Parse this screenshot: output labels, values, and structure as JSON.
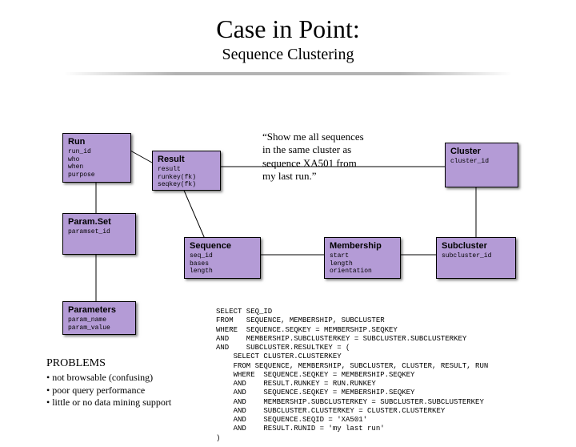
{
  "title": "Case in Point:",
  "subtitle": "Sequence Clustering",
  "quote": "“Show me all sequences\nin the same cluster as\nsequence XA501 from\nmy last run.”",
  "boxes": {
    "run": {
      "title": "Run",
      "fields": "run_id\nwho\nwhen\npurpose"
    },
    "result": {
      "title": "Result",
      "fields": "result\nrunkey(fk)\nseqkey(fk)"
    },
    "cluster": {
      "title": "Cluster",
      "fields": "cluster_id"
    },
    "paramset": {
      "title": "Param.Set",
      "fields": "paramset_id"
    },
    "sequence": {
      "title": "Sequence",
      "fields": "seq_id\nbases\nlength"
    },
    "membership": {
      "title": "Membership",
      "fields": "start\nlength\norientation"
    },
    "subcluster": {
      "title": "Subcluster",
      "fields": "subcluster_id"
    },
    "parameters": {
      "title": "Parameters",
      "fields": "param_name\nparam_value"
    }
  },
  "problems": {
    "heading": "PROBLEMS",
    "items": [
      "not browsable (confusing)",
      "poor query performance",
      "little or no data mining support"
    ]
  },
  "sql": "SELECT SEQ_ID\nFROM   SEQUENCE, MEMBERSHIP, SUBCLUSTER\nWHERE  SEQUENCE.SEQKEY = MEMBERSHIP.SEQKEY\nAND    MEMBERSHIP.SUBCLUSTERKEY = SUBCLUSTER.SUBCLUSTERKEY\nAND    SUBCLUSTER.RESULTKEY = (\n    SELECT CLUSTER.CLUSTERKEY\n    FROM SEQUENCE, MEMBERSHIP, SUBCLUSTER, CLUSTER, RESULT, RUN\n    WHERE  SEQUENCE.SEQKEY = MEMBERSHIP.SEQKEY\n    AND    RESULT.RUNKEY = RUN.RUNKEY\n    AND    SEQUENCE.SEQKEY = MEMBERSHIP.SEQKEY\n    AND    MEMBERSHIP.SUBCLUSTERKEY = SUBCLUSTER.SUBCLUSTERKEY\n    AND    SUBCLUSTER.CLUSTERKEY = CLUSTER.CLUSTERKEY\n    AND    SEQUENCE.SEQID = 'XA501'\n    AND    RESULT.RUNID = 'my last run'\n)",
  "chart_data": {
    "type": "diagram",
    "title": "Sequence Clustering ER diagram",
    "entities": [
      {
        "name": "Run",
        "attributes": [
          "run_id",
          "who",
          "when",
          "purpose"
        ]
      },
      {
        "name": "Result",
        "attributes": [
          "result",
          "runkey(fk)",
          "seqkey(fk)"
        ]
      },
      {
        "name": "Cluster",
        "attributes": [
          "cluster_id"
        ]
      },
      {
        "name": "Param.Set",
        "attributes": [
          "paramset_id"
        ]
      },
      {
        "name": "Sequence",
        "attributes": [
          "seq_id",
          "bases",
          "length"
        ]
      },
      {
        "name": "Membership",
        "attributes": [
          "start",
          "length",
          "orientation"
        ]
      },
      {
        "name": "Subcluster",
        "attributes": [
          "subcluster_id"
        ]
      },
      {
        "name": "Parameters",
        "attributes": [
          "param_name",
          "param_value"
        ]
      }
    ],
    "relationships": [
      [
        "Run",
        "Result"
      ],
      [
        "Run",
        "Param.Set"
      ],
      [
        "Result",
        "Sequence"
      ],
      [
        "Result",
        "Cluster"
      ],
      [
        "Param.Set",
        "Parameters"
      ],
      [
        "Sequence",
        "Membership"
      ],
      [
        "Membership",
        "Subcluster"
      ],
      [
        "Subcluster",
        "Cluster"
      ]
    ]
  }
}
